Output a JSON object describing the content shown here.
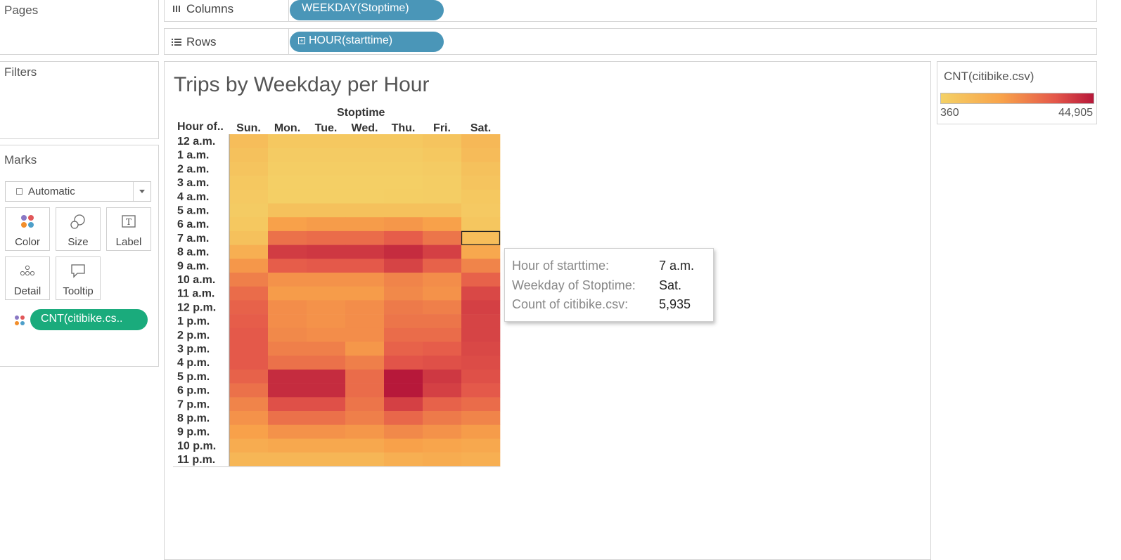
{
  "pages": {
    "title": "Pages"
  },
  "filters": {
    "title": "Filters"
  },
  "marks": {
    "title": "Marks",
    "mark_type": "Automatic",
    "cards": [
      {
        "label": "Color",
        "icon": "color-dots-icon"
      },
      {
        "label": "Size",
        "icon": "size-circles-icon"
      },
      {
        "label": "Label",
        "icon": "text-label-icon"
      },
      {
        "label": "Detail",
        "icon": "detail-dots-icon"
      },
      {
        "label": "Tooltip",
        "icon": "speech-bubble-icon"
      }
    ],
    "color_field": "CNT(citibike.cs.."
  },
  "shelves": {
    "columns_label": "Columns",
    "columns_pill": "WEEKDAY(Stoptime)",
    "rows_label": "Rows",
    "rows_pill": "HOUR(starttime)"
  },
  "legend": {
    "title": "CNT(citibike.csv)",
    "min": "360",
    "max": "44,905",
    "colors": {
      "low": "#f4d166",
      "mid": "#f8a24a",
      "high": "#e4574a",
      "max": "#b7183a"
    }
  },
  "chart_data": {
    "type": "heatmap",
    "title": "Trips by Weekday per Hour",
    "column_header": "Stoptime",
    "row_header": "Hour of..",
    "x": [
      "Sun.",
      "Mon.",
      "Tue.",
      "Wed.",
      "Thu.",
      "Fri.",
      "Sat."
    ],
    "y": [
      "12 a.m.",
      "1 a.m.",
      "2 a.m.",
      "3 a.m.",
      "4 a.m.",
      "5 a.m.",
      "6 a.m.",
      "7 a.m.",
      "8 a.m.",
      "9 a.m.",
      "10 a.m.",
      "11 a.m.",
      "12 p.m.",
      "1 p.m.",
      "2 p.m.",
      "3 p.m.",
      "4 p.m.",
      "5 p.m.",
      "6 p.m.",
      "7 p.m.",
      "8 p.m.",
      "9 p.m.",
      "10 p.m.",
      "11 p.m."
    ],
    "values": [
      [
        6000,
        3000,
        3000,
        3000,
        3000,
        4000,
        7500
      ],
      [
        5000,
        2000,
        2000,
        2000,
        2000,
        3000,
        6500
      ],
      [
        4000,
        1500,
        1500,
        1500,
        1500,
        2000,
        5000
      ],
      [
        3000,
        1000,
        1000,
        1000,
        1000,
        1500,
        4000
      ],
      [
        2500,
        1000,
        1000,
        1000,
        1200,
        1500,
        3000
      ],
      [
        2000,
        5000,
        5000,
        5000,
        5000,
        5000,
        2500
      ],
      [
        3000,
        14000,
        15000,
        15000,
        16000,
        14000,
        3500
      ],
      [
        5000,
        24000,
        25000,
        25000,
        28000,
        23000,
        5935
      ],
      [
        10000,
        36000,
        37000,
        37000,
        40000,
        35000,
        12000
      ],
      [
        16000,
        28000,
        29000,
        29000,
        34000,
        27000,
        20000
      ],
      [
        21000,
        17000,
        17000,
        17000,
        20000,
        18000,
        27000
      ],
      [
        25000,
        15000,
        15000,
        15000,
        19000,
        17000,
        33000
      ],
      [
        27000,
        18000,
        17000,
        18000,
        22000,
        21000,
        35000
      ],
      [
        28000,
        18000,
        17000,
        18000,
        23000,
        23000,
        34000
      ],
      [
        29000,
        19000,
        18000,
        18000,
        25000,
        25000,
        34000
      ],
      [
        29000,
        21000,
        21000,
        16000,
        27000,
        28000,
        33000
      ],
      [
        29000,
        24000,
        24000,
        21000,
        30000,
        31000,
        32000
      ],
      [
        27000,
        40000,
        40000,
        25000,
        44905,
        37000,
        31000
      ],
      [
        24000,
        40000,
        40000,
        25000,
        44905,
        35000,
        29000
      ],
      [
        20000,
        31000,
        31000,
        23000,
        35000,
        27000,
        25000
      ],
      [
        17000,
        24000,
        24000,
        21000,
        26000,
        22000,
        20000
      ],
      [
        14000,
        17000,
        17000,
        16000,
        19000,
        17000,
        15000
      ],
      [
        11000,
        12000,
        12000,
        12000,
        14000,
        13000,
        12000
      ],
      [
        8000,
        8000,
        8000,
        8000,
        10000,
        11000,
        10000
      ]
    ],
    "color_range": [
      360,
      44905
    ],
    "selected": {
      "row": "7 a.m.",
      "col": "Sat."
    }
  },
  "tooltip": {
    "rows": [
      {
        "key": "Hour of starttime:",
        "value": "7 a.m."
      },
      {
        "key": "Weekday of Stoptime:",
        "value": "Sat."
      },
      {
        "key": "Count of citibike.csv:",
        "value": "5,935"
      }
    ]
  }
}
